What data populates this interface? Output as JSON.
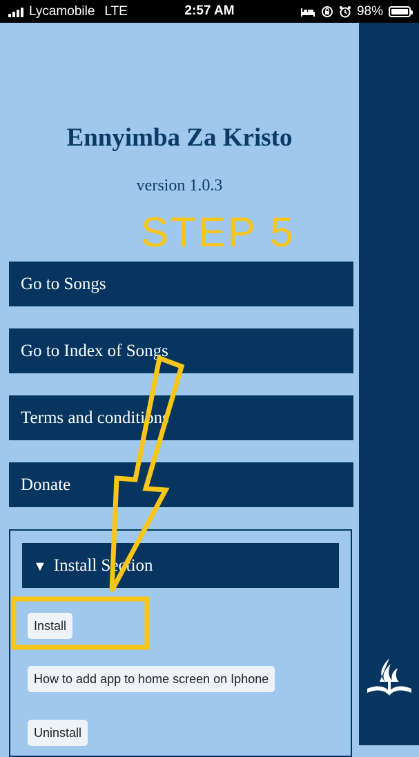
{
  "status_bar": {
    "carrier": "Lycamobile",
    "network": "LTE",
    "time": "2:57 AM",
    "battery": "98%",
    "battery_level": 0.98,
    "icons": [
      "signal-icon",
      "bed-icon",
      "orientation-lock-icon",
      "alarm-icon",
      "battery-icon"
    ]
  },
  "app": {
    "title": "Ennyimba Za Kristo",
    "version": "version 1.0.3"
  },
  "annotation": {
    "step_label": "STEP 5",
    "color": "#f9c516"
  },
  "menu": {
    "items": [
      {
        "label": "Go to Songs"
      },
      {
        "label": "Go to Index of Songs"
      },
      {
        "label": "Terms and conditions"
      },
      {
        "label": "Donate"
      }
    ]
  },
  "install_section": {
    "summary_label": "Install Section",
    "expanded_icon": "triangle-down-icon",
    "buttons": [
      {
        "label": "Install"
      },
      {
        "label": "How to add app to home screen on Iphone"
      },
      {
        "label": "Uninstall"
      }
    ]
  },
  "sidebar": {
    "logo_icon": "church-logo-icon"
  },
  "colors": {
    "background": "#9fc8ec",
    "primary": "#06365f",
    "title_text": "#0b3a66",
    "highlight": "#f9c516"
  }
}
